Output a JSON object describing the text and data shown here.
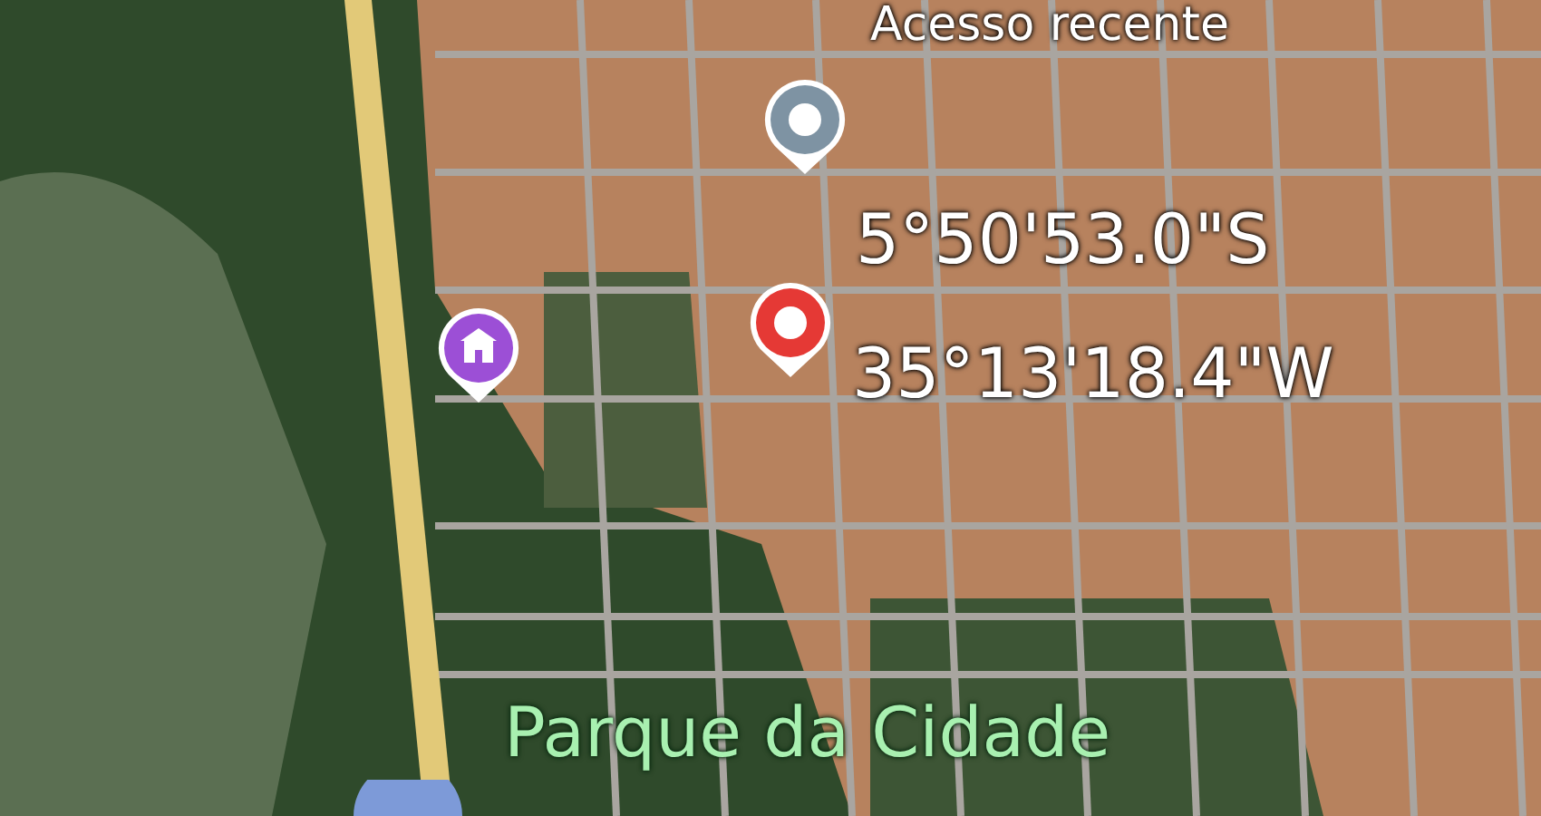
{
  "map": {
    "labels": [
      {
        "text": "Acesso recente",
        "kind": "place"
      },
      {
        "text": "5°50'53.0\"S",
        "kind": "coordinate"
      },
      {
        "text": "35°13'18.4\"W",
        "kind": "coordinate"
      },
      {
        "text": "Parque da Cidade",
        "kind": "park"
      }
    ],
    "pins": [
      {
        "kind": "dot",
        "color": "#7e93a3"
      },
      {
        "kind": "dot",
        "color": "#e53935"
      },
      {
        "kind": "building",
        "color": "#9c4fd6"
      }
    ]
  }
}
